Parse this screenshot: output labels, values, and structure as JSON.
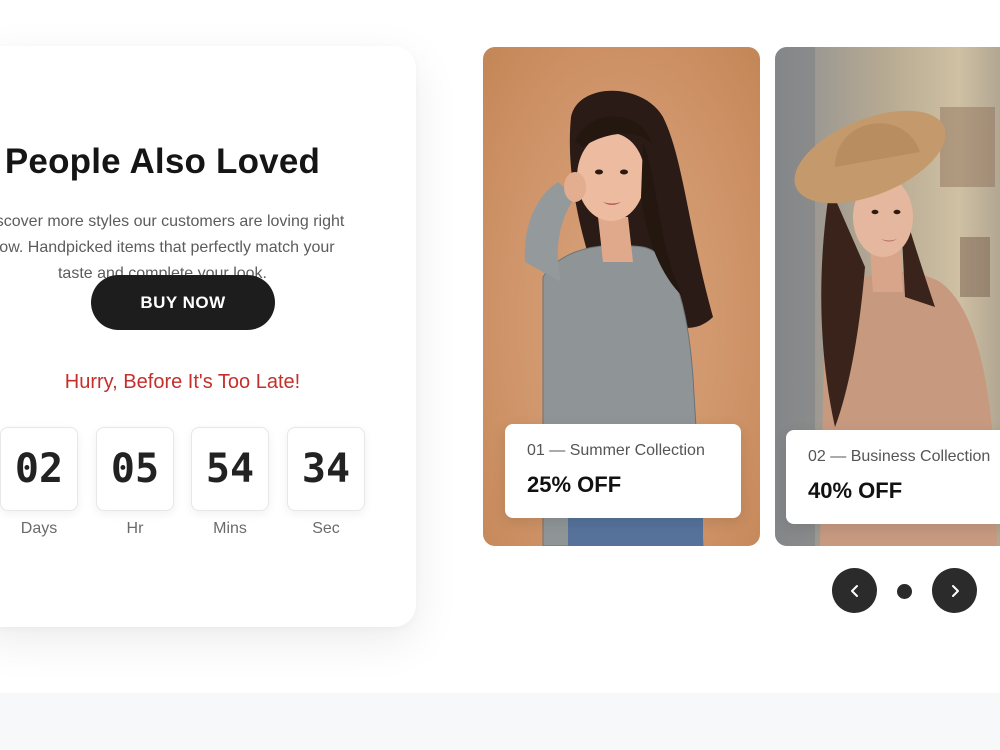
{
  "promo": {
    "title": "People Also Loved",
    "description": "Discover more styles our customers are loving right now. Handpicked items that perfectly match your taste and complete your look.",
    "button_label": "BUY NOW",
    "urgency_text": "Hurry, Before It's Too Late!",
    "countdown": [
      {
        "value": "02",
        "label": "Days"
      },
      {
        "value": "05",
        "label": "Hr"
      },
      {
        "value": "54",
        "label": "Mins"
      },
      {
        "value": "34",
        "label": "Sec"
      }
    ]
  },
  "products": [
    {
      "subtitle": "01 — Summer Collection",
      "discount": "25% OFF"
    },
    {
      "subtitle": "02 — Business Collection",
      "discount": "40% OFF"
    }
  ],
  "carousel": {
    "prev_icon": "chevron-left-icon",
    "next_icon": "chevron-right-icon"
  },
  "colors": {
    "accent_red": "#c4302b",
    "button_dark": "#1d1d1d",
    "nav_dark": "#2b2b2b"
  }
}
